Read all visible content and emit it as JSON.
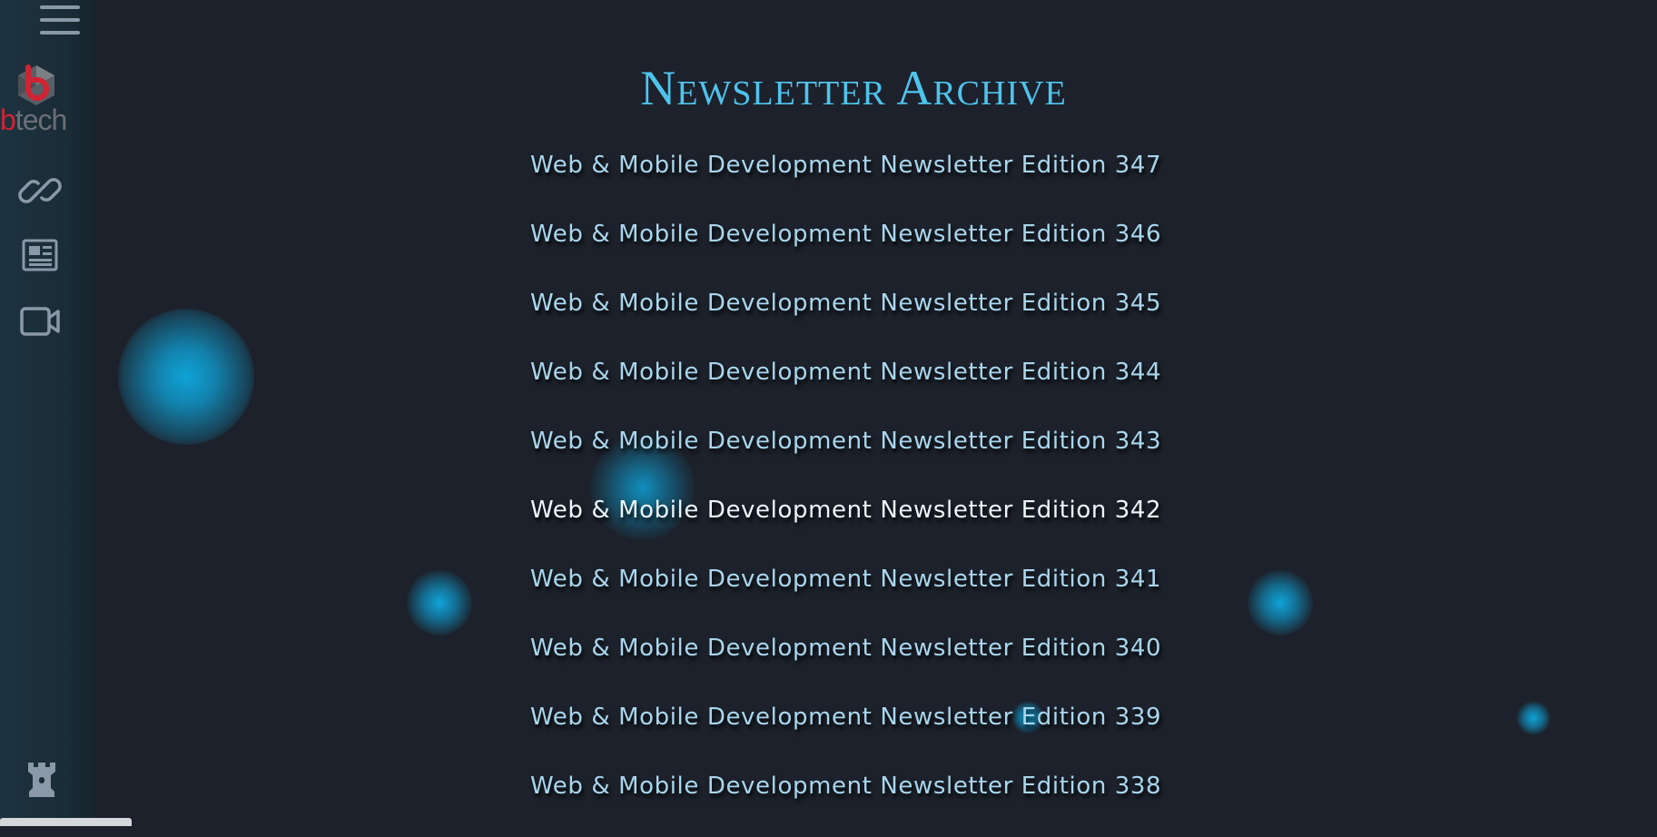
{
  "sidebar": {
    "menu_label": "menu",
    "logo": {
      "letter_b": "b",
      "rest": "tech"
    },
    "icons": [
      "link-icon",
      "newspaper-icon",
      "video-icon",
      "rook-icon"
    ]
  },
  "page": {
    "title": "Newsletter Archive",
    "editions": [
      "Web & Mobile Development Newsletter Edition 347",
      "Web & Mobile Development Newsletter Edition 346",
      "Web & Mobile Development Newsletter Edition 345",
      "Web & Mobile Development Newsletter Edition 344",
      "Web & Mobile Development Newsletter Edition 343",
      "Web & Mobile Development Newsletter Edition 342",
      "Web & Mobile Development Newsletter Edition 341",
      "Web & Mobile Development Newsletter Edition 340",
      "Web & Mobile Development Newsletter Edition 339",
      "Web & Mobile Development Newsletter Edition 338"
    ]
  },
  "colors": {
    "background": "#1c212b",
    "title": "#4fc3ec",
    "link": "#a9d6ec",
    "link_hover": "#eaf6fc",
    "orb": "#0fa3d8",
    "logo_red": "#d02333",
    "logo_gray": "#6b6f76"
  }
}
